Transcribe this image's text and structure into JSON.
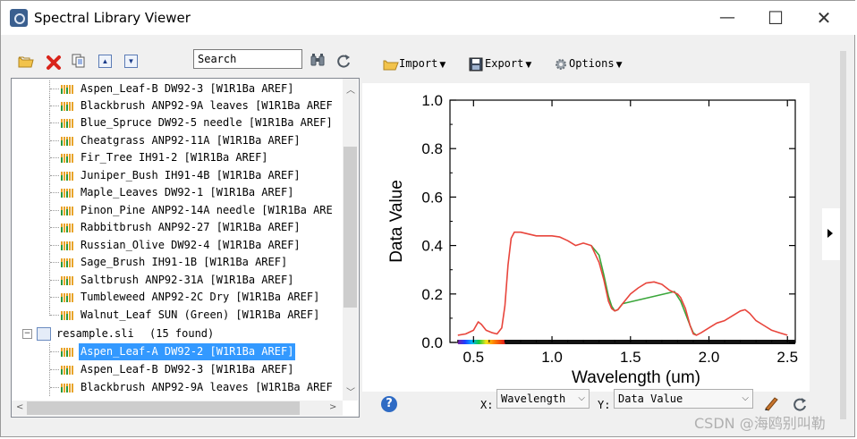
{
  "window": {
    "title": "Spectral Library Viewer",
    "minimize_glyph": "—",
    "maximize_glyph": "☐",
    "close_glyph": "✕"
  },
  "toolbar": {
    "search_value": "Search",
    "icons": [
      "open-folder-icon",
      "delete-icon",
      "copy-icon",
      "move-up-icon",
      "move-down-icon",
      "find-icon",
      "refresh-icon"
    ]
  },
  "tree": {
    "items": [
      "Aspen_Leaf-B DW92-3 [W1R1Ba AREF]",
      "Blackbrush ANP92-9A leaves [W1R1Ba AREF",
      "Blue_Spruce DW92-5 needle [W1R1Ba AREF]",
      "Cheatgrass ANP92-11A [W1R1Ba AREF]",
      "Fir_Tree IH91-2 [W1R1Ba AREF]",
      "Juniper_Bush IH91-4B [W1R1Ba AREF]",
      "Maple_Leaves DW92-1 [W1R1Ba AREF]",
      "Pinon_Pine ANP92-14A needle [W1R1Ba ARE",
      "Rabbitbrush ANP92-27 [W1R1Ba AREF]",
      "Russian_Olive DW92-4 [W1R1Ba AREF]",
      "Sage_Brush IH91-1B [W1R1Ba AREF]",
      "Saltbrush ANP92-31A [W1R1Ba AREF]",
      "Tumbleweed ANP92-2C Dry [W1R1Ba AREF]",
      "Walnut_Leaf SUN (Green) [W1R1Ba AREF]"
    ],
    "library": {
      "name": "resample.sli",
      "count": "(15 found)",
      "expander": "−"
    },
    "library_items": [
      "Aspen_Leaf-A DW92-2 [W1R1Ba AREF]",
      "Aspen_Leaf-B DW92-3 [W1R1Ba AREF]",
      "Blackbrush ANP92-9A leaves [W1R1Ba AREF"
    ],
    "selected_library_item": 0
  },
  "plot_toolbar": {
    "import_label": "Import",
    "export_label": "Export",
    "options_label": "Options"
  },
  "chart_data": {
    "type": "line",
    "title": "",
    "xlabel": "Wavelength (um)",
    "ylabel": "Data Value",
    "xlim": [
      0.35,
      2.55
    ],
    "ylim": [
      0.0,
      1.0
    ],
    "x_ticks": [
      "0.5",
      "1.0",
      "1.5",
      "2.0",
      "2.5"
    ],
    "y_ticks": [
      "0.0",
      "0.2",
      "0.4",
      "0.6",
      "0.8",
      "1.0"
    ],
    "grid": false,
    "series": [
      {
        "color": "#e8453c",
        "x": [
          0.4,
          0.45,
          0.5,
          0.53,
          0.55,
          0.58,
          0.62,
          0.65,
          0.68,
          0.7,
          0.72,
          0.74,
          0.76,
          0.8,
          0.9,
          1.0,
          1.05,
          1.1,
          1.15,
          1.2,
          1.25,
          1.3,
          1.33,
          1.36,
          1.38,
          1.4,
          1.42,
          1.45,
          1.5,
          1.55,
          1.6,
          1.65,
          1.7,
          1.75,
          1.8,
          1.82,
          1.85,
          1.88,
          1.9,
          1.92,
          1.95,
          2.0,
          2.05,
          2.1,
          2.15,
          2.2,
          2.23,
          2.26,
          2.3,
          2.35,
          2.4,
          2.45,
          2.5
        ],
        "y": [
          0.03,
          0.035,
          0.05,
          0.085,
          0.075,
          0.05,
          0.04,
          0.035,
          0.06,
          0.15,
          0.32,
          0.43,
          0.455,
          0.455,
          0.44,
          0.44,
          0.435,
          0.42,
          0.4,
          0.41,
          0.4,
          0.33,
          0.26,
          0.17,
          0.14,
          0.13,
          0.135,
          0.16,
          0.2,
          0.225,
          0.245,
          0.25,
          0.24,
          0.215,
          0.2,
          0.185,
          0.14,
          0.07,
          0.035,
          0.03,
          0.04,
          0.06,
          0.08,
          0.09,
          0.11,
          0.13,
          0.135,
          0.12,
          0.09,
          0.07,
          0.05,
          0.04,
          0.03
        ]
      },
      {
        "color": "#3aa63a",
        "x": [
          1.25,
          1.3,
          1.33,
          1.36,
          1.38,
          1.4,
          1.42,
          1.45,
          1.78,
          1.82,
          1.85,
          1.88,
          1.9,
          1.92
        ],
        "y": [
          0.4,
          0.36,
          0.28,
          0.19,
          0.15,
          0.13,
          0.135,
          0.16,
          0.21,
          0.17,
          0.12,
          0.07,
          0.04,
          0.03
        ]
      }
    ]
  },
  "axes_controls": {
    "x_label": "X:",
    "x_value": "Wavelength",
    "y_label": "Y:",
    "y_value": "Data Value"
  },
  "watermark": "CSDN @海鸥别叫勒"
}
